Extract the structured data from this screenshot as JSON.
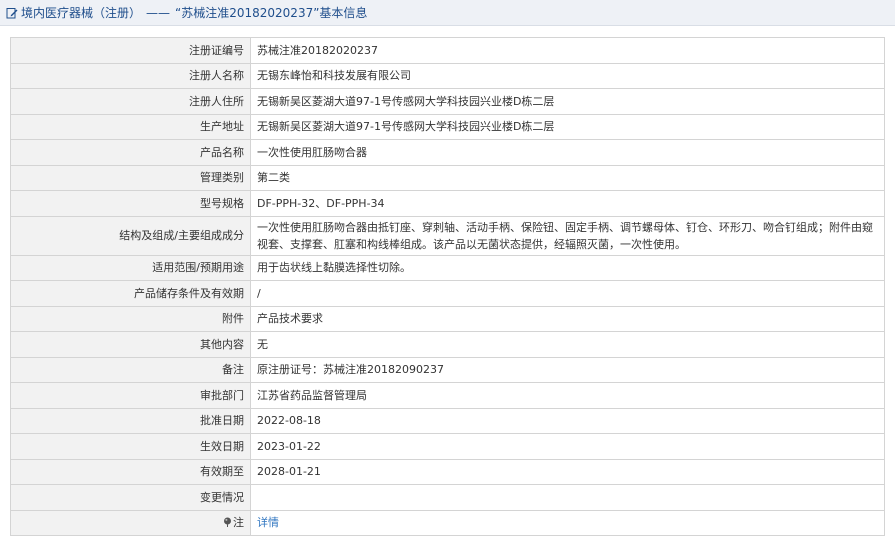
{
  "header": {
    "category": "境内医疗器械（注册）",
    "separator": "——",
    "title": "“苏械注准20182020237”基本信息"
  },
  "rows": [
    {
      "label": "注册证编号",
      "value": "苏械注准20182020237"
    },
    {
      "label": "注册人名称",
      "value": "无锡东峰怡和科技发展有限公司"
    },
    {
      "label": "注册人住所",
      "value": "无锡新吴区菱湖大道97-1号传感网大学科技园兴业楼D栋二层"
    },
    {
      "label": "生产地址",
      "value": "无锡新吴区菱湖大道97-1号传感网大学科技园兴业楼D栋二层"
    },
    {
      "label": "产品名称",
      "value": "一次性使用肛肠吻合器"
    },
    {
      "label": "管理类别",
      "value": "第二类"
    },
    {
      "label": "型号规格",
      "value": "DF-PPH-32、DF-PPH-34"
    },
    {
      "label": "结构及组成/主要组成成分",
      "value": "一次性使用肛肠吻合器由抵钉座、穿刺轴、活动手柄、保险钮、固定手柄、调节螺母体、钉仓、环形刀、吻合钉组成；附件由窥视套、支撑套、肛塞和构线棒组成。该产品以无菌状态提供，经辐照灭菌，一次性使用。"
    },
    {
      "label": "适用范围/预期用途",
      "value": "用于齿状线上黏膜选择性切除。"
    },
    {
      "label": "产品储存条件及有效期",
      "value": "/"
    },
    {
      "label": "附件",
      "value": "产品技术要求"
    },
    {
      "label": "其他内容",
      "value": "无"
    },
    {
      "label": "备注",
      "value": "原注册证号：苏械注准20182090237"
    },
    {
      "label": "审批部门",
      "value": "江苏省药品监督管理局"
    },
    {
      "label": "批准日期",
      "value": "2022-08-18"
    },
    {
      "label": "生效日期",
      "value": "2023-01-22"
    },
    {
      "label": "有效期至",
      "value": "2028-01-21"
    },
    {
      "label": "变更情况",
      "value": ""
    }
  ],
  "note": {
    "label": "注",
    "link_text": "详情"
  },
  "icons": {
    "header_icon": "edit-icon",
    "note_icon": "pin-icon"
  },
  "colors": {
    "header_text": "#1f4e8c",
    "link": "#2f75c0",
    "label_bg": "#f2f2f2",
    "header_bg": "#eef1f6"
  }
}
